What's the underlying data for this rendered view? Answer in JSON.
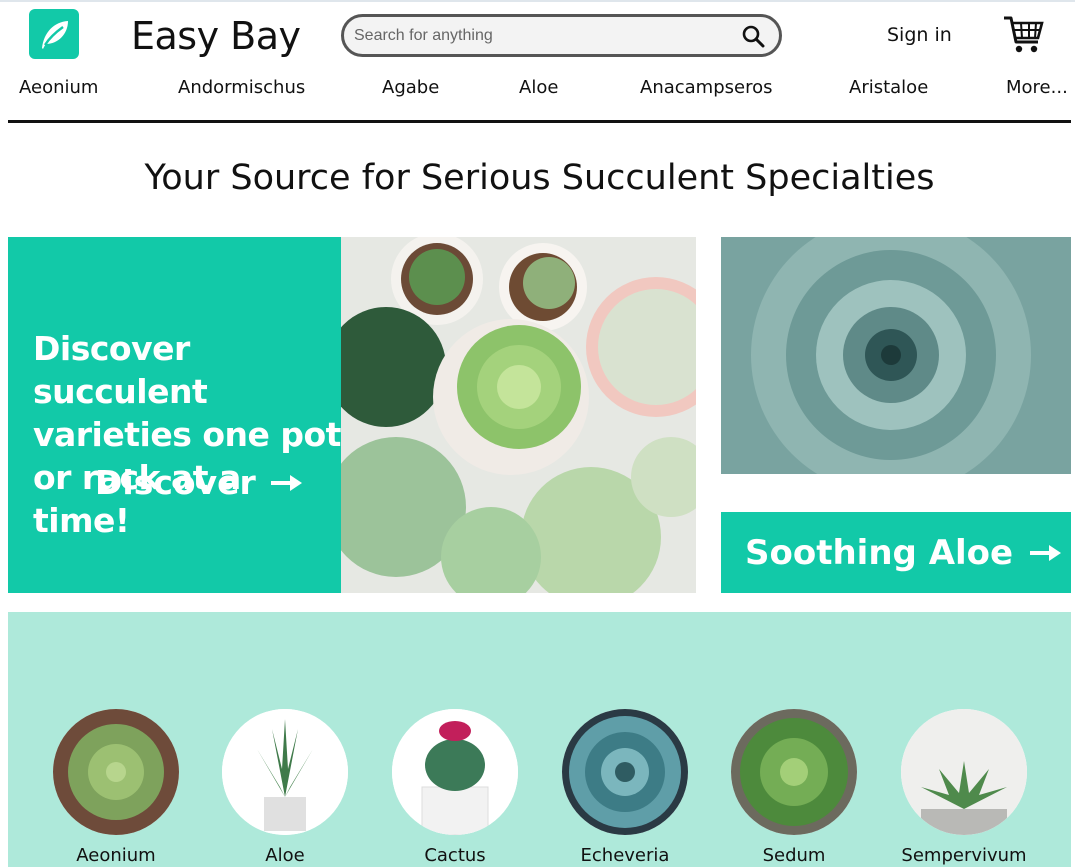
{
  "header": {
    "brand": "Easy Bay",
    "search_placeholder": "Search for anything",
    "sign_in": "Sign in"
  },
  "nav": [
    "Aeonium",
    "Andormischus",
    "Agabe",
    "Aloe",
    "Anacampseros",
    "Aristaloe",
    "More..."
  ],
  "headline": "Your Source for Serious Succulent Specialties",
  "hero": {
    "text": "Discover succulent varieties one pot or rack at a time!",
    "cta": "Discover"
  },
  "promo": {
    "cta": "Soothing Aloe"
  },
  "categories": [
    "Aeonium",
    "Aloe",
    "Cactus",
    "Echeveria",
    "Sedum",
    "Sempervivum"
  ],
  "colors": {
    "accent": "#12c9a8",
    "band": "#aee9da"
  },
  "icons": [
    "leaf-logo-icon",
    "search-icon",
    "cart-icon",
    "arrow-right-icon"
  ]
}
